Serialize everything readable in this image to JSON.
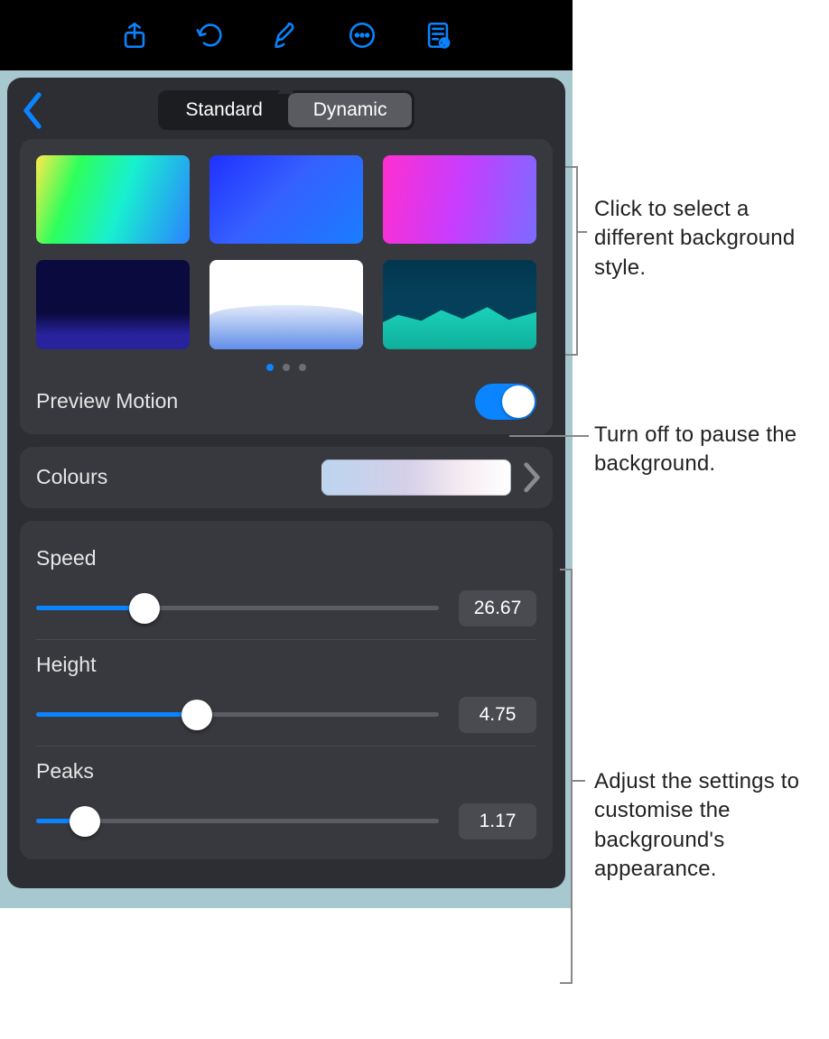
{
  "tabs": {
    "standard": "Standard",
    "dynamic": "Dynamic"
  },
  "preview_motion_label": "Preview Motion",
  "colours_label": "Colours",
  "sliders": {
    "speed": {
      "label": "Speed",
      "value": "26.67",
      "fill_pct": 27
    },
    "height": {
      "label": "Height",
      "value": "4.75",
      "fill_pct": 40
    },
    "peaks": {
      "label": "Peaks",
      "value": "1.17",
      "fill_pct": 12
    }
  },
  "callouts": {
    "styles": "Click to select a different background style.",
    "preview": "Turn off to pause the background.",
    "sliders": "Adjust the settings to customise the background's appearance."
  }
}
